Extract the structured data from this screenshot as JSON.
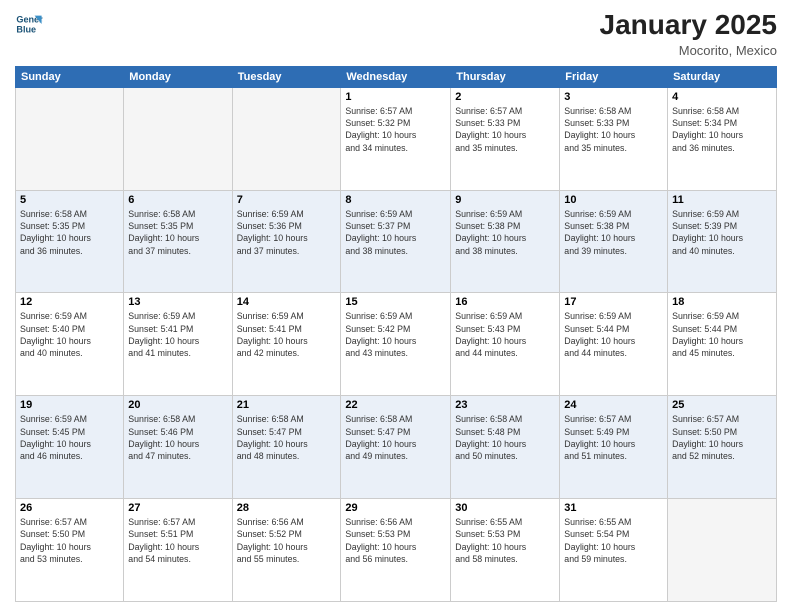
{
  "header": {
    "logo_line1": "General",
    "logo_line2": "Blue",
    "month": "January 2025",
    "location": "Mocorito, Mexico"
  },
  "weekdays": [
    "Sunday",
    "Monday",
    "Tuesday",
    "Wednesday",
    "Thursday",
    "Friday",
    "Saturday"
  ],
  "weeks": [
    [
      {
        "day": "",
        "info": ""
      },
      {
        "day": "",
        "info": ""
      },
      {
        "day": "",
        "info": ""
      },
      {
        "day": "1",
        "info": "Sunrise: 6:57 AM\nSunset: 5:32 PM\nDaylight: 10 hours\nand 34 minutes."
      },
      {
        "day": "2",
        "info": "Sunrise: 6:57 AM\nSunset: 5:33 PM\nDaylight: 10 hours\nand 35 minutes."
      },
      {
        "day": "3",
        "info": "Sunrise: 6:58 AM\nSunset: 5:33 PM\nDaylight: 10 hours\nand 35 minutes."
      },
      {
        "day": "4",
        "info": "Sunrise: 6:58 AM\nSunset: 5:34 PM\nDaylight: 10 hours\nand 36 minutes."
      }
    ],
    [
      {
        "day": "5",
        "info": "Sunrise: 6:58 AM\nSunset: 5:35 PM\nDaylight: 10 hours\nand 36 minutes."
      },
      {
        "day": "6",
        "info": "Sunrise: 6:58 AM\nSunset: 5:35 PM\nDaylight: 10 hours\nand 37 minutes."
      },
      {
        "day": "7",
        "info": "Sunrise: 6:59 AM\nSunset: 5:36 PM\nDaylight: 10 hours\nand 37 minutes."
      },
      {
        "day": "8",
        "info": "Sunrise: 6:59 AM\nSunset: 5:37 PM\nDaylight: 10 hours\nand 38 minutes."
      },
      {
        "day": "9",
        "info": "Sunrise: 6:59 AM\nSunset: 5:38 PM\nDaylight: 10 hours\nand 38 minutes."
      },
      {
        "day": "10",
        "info": "Sunrise: 6:59 AM\nSunset: 5:38 PM\nDaylight: 10 hours\nand 39 minutes."
      },
      {
        "day": "11",
        "info": "Sunrise: 6:59 AM\nSunset: 5:39 PM\nDaylight: 10 hours\nand 40 minutes."
      }
    ],
    [
      {
        "day": "12",
        "info": "Sunrise: 6:59 AM\nSunset: 5:40 PM\nDaylight: 10 hours\nand 40 minutes."
      },
      {
        "day": "13",
        "info": "Sunrise: 6:59 AM\nSunset: 5:41 PM\nDaylight: 10 hours\nand 41 minutes."
      },
      {
        "day": "14",
        "info": "Sunrise: 6:59 AM\nSunset: 5:41 PM\nDaylight: 10 hours\nand 42 minutes."
      },
      {
        "day": "15",
        "info": "Sunrise: 6:59 AM\nSunset: 5:42 PM\nDaylight: 10 hours\nand 43 minutes."
      },
      {
        "day": "16",
        "info": "Sunrise: 6:59 AM\nSunset: 5:43 PM\nDaylight: 10 hours\nand 44 minutes."
      },
      {
        "day": "17",
        "info": "Sunrise: 6:59 AM\nSunset: 5:44 PM\nDaylight: 10 hours\nand 44 minutes."
      },
      {
        "day": "18",
        "info": "Sunrise: 6:59 AM\nSunset: 5:44 PM\nDaylight: 10 hours\nand 45 minutes."
      }
    ],
    [
      {
        "day": "19",
        "info": "Sunrise: 6:59 AM\nSunset: 5:45 PM\nDaylight: 10 hours\nand 46 minutes."
      },
      {
        "day": "20",
        "info": "Sunrise: 6:58 AM\nSunset: 5:46 PM\nDaylight: 10 hours\nand 47 minutes."
      },
      {
        "day": "21",
        "info": "Sunrise: 6:58 AM\nSunset: 5:47 PM\nDaylight: 10 hours\nand 48 minutes."
      },
      {
        "day": "22",
        "info": "Sunrise: 6:58 AM\nSunset: 5:47 PM\nDaylight: 10 hours\nand 49 minutes."
      },
      {
        "day": "23",
        "info": "Sunrise: 6:58 AM\nSunset: 5:48 PM\nDaylight: 10 hours\nand 50 minutes."
      },
      {
        "day": "24",
        "info": "Sunrise: 6:57 AM\nSunset: 5:49 PM\nDaylight: 10 hours\nand 51 minutes."
      },
      {
        "day": "25",
        "info": "Sunrise: 6:57 AM\nSunset: 5:50 PM\nDaylight: 10 hours\nand 52 minutes."
      }
    ],
    [
      {
        "day": "26",
        "info": "Sunrise: 6:57 AM\nSunset: 5:50 PM\nDaylight: 10 hours\nand 53 minutes."
      },
      {
        "day": "27",
        "info": "Sunrise: 6:57 AM\nSunset: 5:51 PM\nDaylight: 10 hours\nand 54 minutes."
      },
      {
        "day": "28",
        "info": "Sunrise: 6:56 AM\nSunset: 5:52 PM\nDaylight: 10 hours\nand 55 minutes."
      },
      {
        "day": "29",
        "info": "Sunrise: 6:56 AM\nSunset: 5:53 PM\nDaylight: 10 hours\nand 56 minutes."
      },
      {
        "day": "30",
        "info": "Sunrise: 6:55 AM\nSunset: 5:53 PM\nDaylight: 10 hours\nand 58 minutes."
      },
      {
        "day": "31",
        "info": "Sunrise: 6:55 AM\nSunset: 5:54 PM\nDaylight: 10 hours\nand 59 minutes."
      },
      {
        "day": "",
        "info": ""
      }
    ]
  ]
}
